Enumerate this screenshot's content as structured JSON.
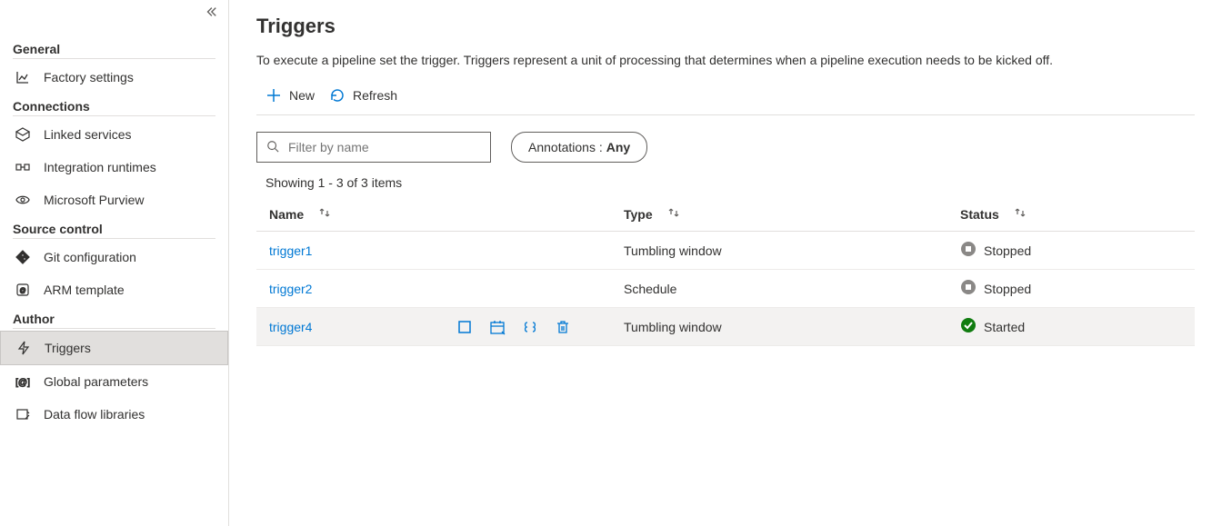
{
  "sidebar": {
    "sections": [
      {
        "title": "General",
        "items": [
          {
            "label": "Factory settings",
            "icon": "chart-icon"
          }
        ]
      },
      {
        "title": "Connections",
        "items": [
          {
            "label": "Linked services",
            "icon": "cube-icon"
          },
          {
            "label": "Integration runtimes",
            "icon": "runtime-icon"
          },
          {
            "label": "Microsoft Purview",
            "icon": "eye-icon"
          }
        ]
      },
      {
        "title": "Source control",
        "items": [
          {
            "label": "Git configuration",
            "icon": "git-icon"
          },
          {
            "label": "ARM template",
            "icon": "arm-icon"
          }
        ]
      },
      {
        "title": "Author",
        "items": [
          {
            "label": "Triggers",
            "icon": "bolt-icon",
            "active": true
          },
          {
            "label": "Global parameters",
            "icon": "param-icon"
          },
          {
            "label": "Data flow libraries",
            "icon": "library-icon"
          }
        ]
      }
    ]
  },
  "page": {
    "title": "Triggers",
    "description": "To execute a pipeline set the trigger. Triggers represent a unit of processing that determines when a pipeline execution needs to be kicked off."
  },
  "toolbar": {
    "new_label": "New",
    "refresh_label": "Refresh"
  },
  "filter": {
    "placeholder": "Filter by name",
    "annotations_label": "Annotations :",
    "annotations_value": "Any"
  },
  "count_text": "Showing 1 - 3 of 3 items",
  "columns": {
    "name": "Name",
    "type": "Type",
    "status": "Status"
  },
  "rows": [
    {
      "name": "trigger1",
      "type": "Tumbling window",
      "status": "Stopped",
      "status_kind": "stopped",
      "hover": false
    },
    {
      "name": "trigger2",
      "type": "Schedule",
      "status": "Stopped",
      "status_kind": "stopped",
      "hover": false
    },
    {
      "name": "trigger4",
      "type": "Tumbling window",
      "status": "Started",
      "status_kind": "started",
      "hover": true
    }
  ]
}
